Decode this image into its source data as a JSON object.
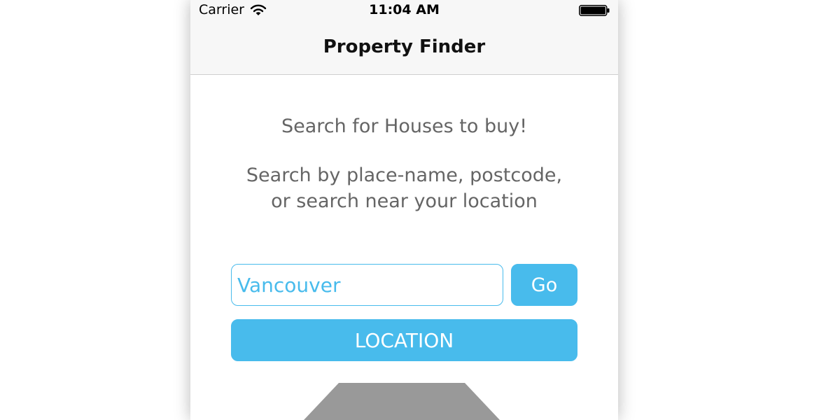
{
  "status_bar": {
    "carrier": "Carrier",
    "time": "11:04 AM",
    "wifi_icon": "wifi-icon",
    "battery_icon": "battery-icon"
  },
  "nav": {
    "title": "Property Finder"
  },
  "main": {
    "description_1": "Search for Houses to buy!",
    "description_2": "Search by place-name, postcode, or search near your location",
    "search_value": "Vancouver",
    "go_label": "Go",
    "location_label": "LOCATION",
    "image_icon": "house-icon"
  },
  "colors": {
    "accent": "#48BBEC",
    "text": "#656565",
    "nav_background": "#F7F7F7",
    "image_gray": "#999999"
  }
}
